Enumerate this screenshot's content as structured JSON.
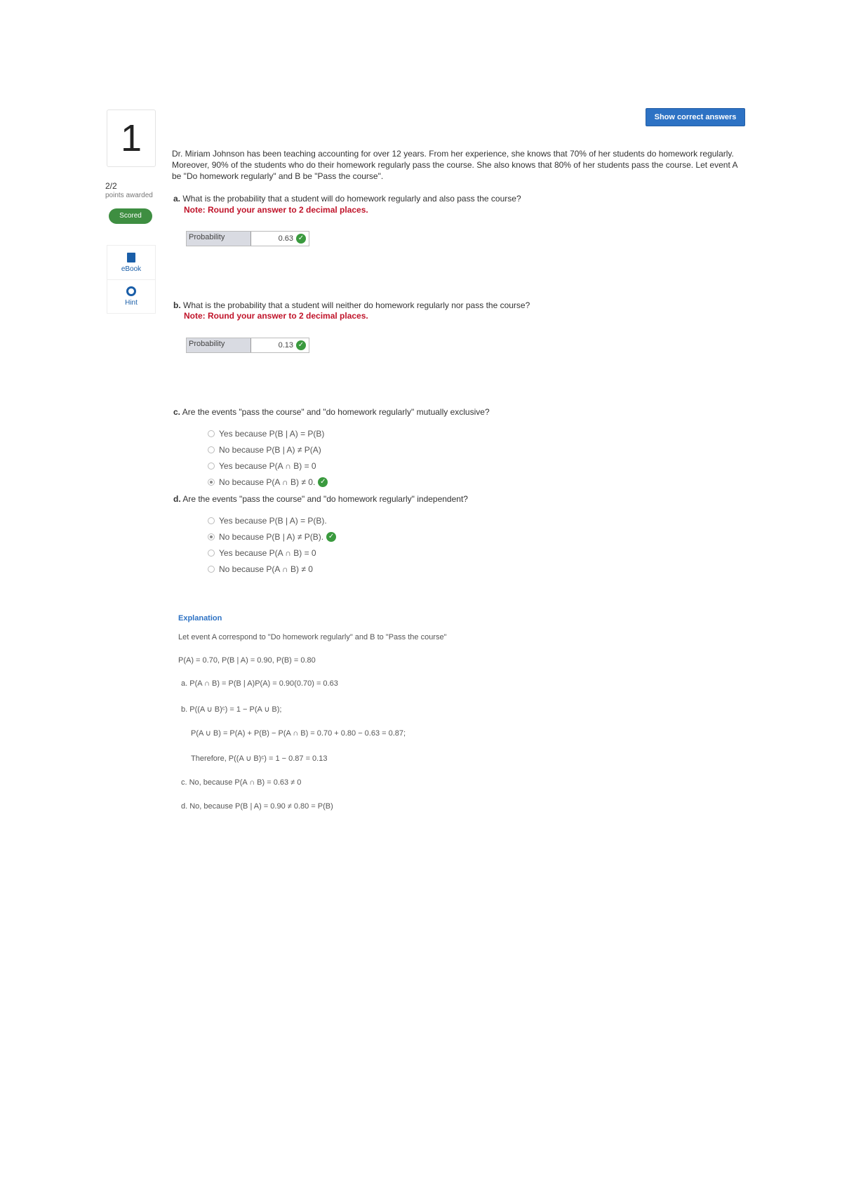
{
  "question": {
    "number": "1",
    "points": "2/2",
    "points_sub": "points awarded",
    "scored_label": "Scored",
    "tools": [
      {
        "label": "eBook",
        "icon": "book-icon"
      },
      {
        "label": "Hint",
        "icon": "lifebuoy-icon"
      }
    ],
    "show_answers_label": "Show correct answers",
    "prompt": "Dr. Miriam Johnson has been teaching accounting for over 12 years. From her experience, she knows that 70% of her students do homework regularly. Moreover, 90% of the students who do their homework regularly pass the course. She also knows that 80% of her students pass the course. Let event A be \"Do homework regularly\" and B be \"Pass the course\"."
  },
  "part_a": {
    "label": "a.",
    "text": "What is the probability that a student will do homework regularly and also pass the course?",
    "note": "Note: Round your answer to 2 decimal places.",
    "answer_label": "Probability",
    "answer_value": "0.63"
  },
  "part_b": {
    "label": "b.",
    "text": "What is the probability that a student will neither do homework regularly nor pass the course?",
    "note": "Note: Round your answer to 2 decimal places.",
    "answer_label": "Probability",
    "answer_value": "0.13"
  },
  "part_c": {
    "label": "c.",
    "text": "Are the events \"pass the course\" and \"do homework regularly\" mutually exclusive?",
    "options": [
      "Yes because P(B | A) = P(B)",
      "No because P(B | A) ≠ P(A)",
      "Yes because P(A ∩ B) = 0",
      "No because P(A ∩ B) ≠ 0."
    ],
    "selected": 3
  },
  "part_d": {
    "label": "d.",
    "text": "Are the events \"pass the course\" and \"do homework regularly\" independent?",
    "options": [
      "Yes because P(B | A) = P(B).",
      "No because P(B | A) ≠ P(B).",
      "Yes because P(A ∩ B) = 0",
      "No because P(A ∩ B) ≠ 0"
    ],
    "selected": 1
  },
  "explanation": {
    "title": "Explanation",
    "line1": "Let event A correspond to \"Do homework regularly\" and B to \"Pass the course\"",
    "line2": "P(A) = 0.70, P(B | A) = 0.90, P(B) = 0.80",
    "a": "a. P(A ∩ B) = P(B | A)P(A) = 0.90(0.70) = 0.63",
    "b1": "b. P((A ∪ B)ᶜ) = 1 − P(A ∪ B);",
    "b2": "P(A ∪ B) = P(A) + P(B) − P(A ∩ B) = 0.70 + 0.80 − 0.63 = 0.87;",
    "b3": "Therefore, P((A ∪ B)ᶜ) = 1 − 0.87 = 0.13",
    "c": "c. No, because P(A ∩ B) = 0.63 ≠ 0",
    "d": "d. No, because P(B | A) = 0.90 ≠ 0.80 = P(B)"
  }
}
